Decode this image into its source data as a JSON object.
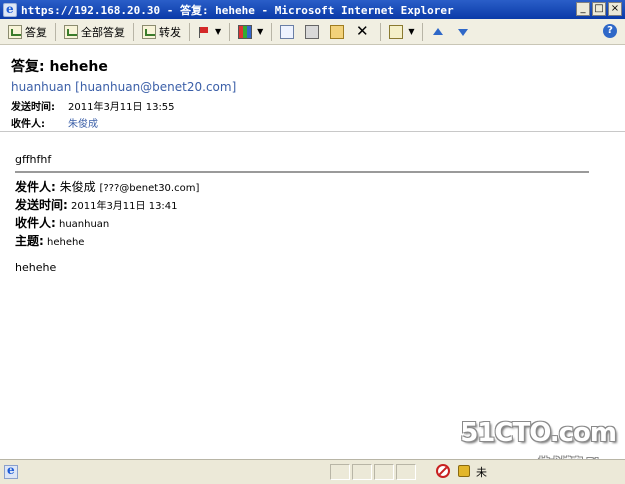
{
  "window": {
    "title": "https://192.168.20.30 - 答复: hehehe - Microsoft Internet Explorer",
    "buttons": {
      "minimize": "_",
      "maximize": "□",
      "close": "×"
    }
  },
  "toolbar": {
    "reply": "答复",
    "reply_all": "全部答复",
    "forward": "转发",
    "help": "?"
  },
  "message": {
    "subject": "答复: hehehe",
    "from": "huanhuan [huanhuan@benet20.com]",
    "sent_label": "发送时间:",
    "sent_value": "2011年3月11日 13:55",
    "to_label": "收件人:",
    "to_value": "朱俊成"
  },
  "body": {
    "first_line": "gffhfhf",
    "quote": {
      "from_label": "发件人:",
      "from_name": " 朱俊成 ",
      "from_email": "[???@benet30.com]",
      "sent_label": "发送时间:",
      "sent_value": " 2011年3月11日 13:41",
      "to_label": "收件人:",
      "to_value": " huanhuan",
      "subject_label": "主题:",
      "subject_value": " hehehe"
    },
    "last_line": "hehehe"
  },
  "watermark": {
    "main": "51CTO.com",
    "sub": "技术博客 Blog"
  },
  "statusbar": {
    "zone_text": "未"
  },
  "icons": [
    "ie-icon",
    "reply-icon",
    "reply-all-icon",
    "forward-icon",
    "flag-icon",
    "categorize-icon",
    "copy-icon",
    "print-icon",
    "move-icon",
    "delete-icon",
    "rules-icon",
    "previous-icon",
    "next-icon",
    "help-icon",
    "popup-blocked-icon",
    "lock-icon"
  ]
}
